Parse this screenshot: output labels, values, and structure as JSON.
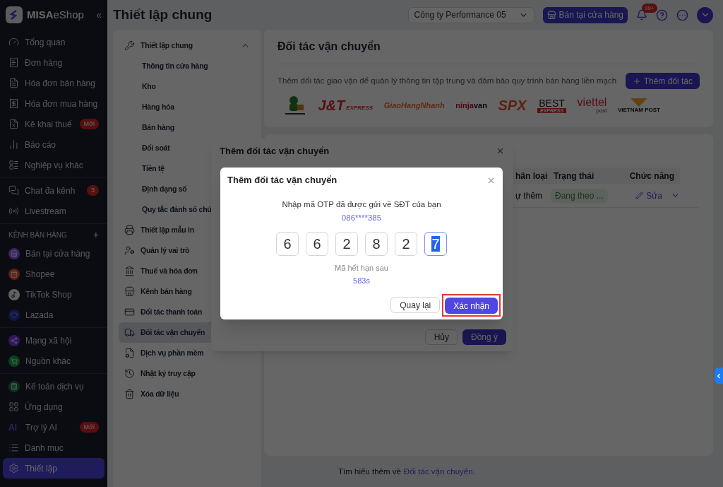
{
  "sidebar": {
    "brand": "MISA",
    "brand_suffix": "eShop",
    "collapse": "«",
    "groups": [
      {
        "items": [
          {
            "label": "Tổng quan",
            "selected": false
          },
          {
            "label": "Đơn hàng",
            "selected": false
          },
          {
            "label": "Hóa đơn bán hàng",
            "selected": false
          },
          {
            "label": "Hóa đơn mua hàng",
            "selected": false
          },
          {
            "label": "Kê khai thuế",
            "badge": "Mới",
            "selected": false
          },
          {
            "label": "Báo cáo",
            "selected": false
          },
          {
            "label": "Nghiệp vụ khác",
            "selected": false
          }
        ]
      },
      {
        "items": [
          {
            "label": "Chat đa kênh",
            "badge": "3",
            "selected": false
          },
          {
            "label": "Livestream",
            "selected": false
          }
        ]
      },
      {
        "heading": "KÊNH BÁN HÀNG",
        "heading_action": "+",
        "items": [
          {
            "label": "Bán tại cửa hàng",
            "selected": false
          },
          {
            "label": "Shopee",
            "selected": false
          },
          {
            "label": "TikTok Shop",
            "selected": false
          },
          {
            "label": "Lazada",
            "selected": false
          }
        ]
      },
      {
        "items": [
          {
            "label": "Mạng xã hội",
            "selected": false
          },
          {
            "label": "Nguồn khác",
            "selected": false
          }
        ]
      },
      {
        "items": [
          {
            "label": "Kế toán dịch vụ",
            "selected": false
          },
          {
            "label": "Ứng dụng",
            "selected": false
          },
          {
            "label": "Trợ lý AI",
            "icon_text": "Ai",
            "badge": "Mới",
            "selected": false
          },
          {
            "label": "Danh mục",
            "selected": false
          },
          {
            "label": "Thiết lập",
            "selected": true
          }
        ]
      }
    ]
  },
  "header": {
    "title": "Thiết lập chung",
    "company": "Công ty Performance 05",
    "store_button": "Bán tại cửa hàng",
    "notifications": "99+"
  },
  "settings_nav": [
    {
      "label": "Thiết lập chung",
      "expanded": true,
      "children": [
        {
          "label": "Thông tin cửa hàng"
        },
        {
          "label": "Kho"
        },
        {
          "label": "Hàng hóa"
        },
        {
          "label": "Bán hàng"
        },
        {
          "label": "Đối soát"
        },
        {
          "label": "Tiền tệ"
        },
        {
          "label": "Định dạng số"
        },
        {
          "label": "Quy tắc đánh số chứ"
        }
      ]
    },
    {
      "label": "Thiết lập mẫu in",
      "selected": false
    },
    {
      "label": "Quản lý vai trò",
      "selected": false
    },
    {
      "label": "Thuế và hóa đơn",
      "selected": false
    },
    {
      "label": "Kênh bán hàng",
      "selected": false
    },
    {
      "label": "Đối tác thanh toán",
      "selected": false
    },
    {
      "label": "Đối tác vận chuyển",
      "selected": true
    },
    {
      "label": "Dịch vụ phần mềm",
      "selected": false
    },
    {
      "label": "Nhật ký truy cập",
      "selected": false
    },
    {
      "label": "Xóa dữ liệu",
      "selected": false
    }
  ],
  "partners": {
    "title": "Đối tác vận chuyển",
    "description": "Thêm đối tác giao vận để quản lý thông tin tập trung và đảm bảo quy trình bán hàng liền mạch",
    "add_button": "Thêm đối tác",
    "logos": [
      {
        "kind": "mascot"
      },
      {
        "kind": "jt",
        "text": "J&T",
        "sub": "EXPRESS"
      },
      {
        "kind": "ghn",
        "text": "GiaoHangNhanh"
      },
      {
        "kind": "ninja",
        "text": "ninja",
        "sub": "van"
      },
      {
        "kind": "spx",
        "text": "SPX"
      },
      {
        "kind": "best",
        "text": "BEST",
        "sub": "EXPRESS"
      },
      {
        "kind": "viettel",
        "text": "viettel",
        "sub": "post"
      },
      {
        "kind": "vnpost",
        "sub": "VIETNAM POST"
      }
    ]
  },
  "table": {
    "columns": [
      "hân loại",
      "Trạng thái",
      "Chức năng"
    ],
    "rows": [
      {
        "type": "ự thêm",
        "status": "Đang theo ...",
        "action": "Sửa"
      }
    ]
  },
  "footer": {
    "text": "Tìm hiểu thêm về",
    "link": "Đối tác vận chuyển."
  },
  "add_dialog": {
    "title": "Thêm đối tác vận chuyển",
    "cancel": "Hủy",
    "ok": "Đồng ý"
  },
  "otp_dialog": {
    "title": "Thêm đối tác vận chuyển",
    "prompt": "Nhập mã OTP đã được gửi về SĐT của bạn",
    "phone": "086****385",
    "digits": [
      {
        "value": "6",
        "selected": false
      },
      {
        "value": "6",
        "selected": false
      },
      {
        "value": "2",
        "selected": false
      },
      {
        "value": "8",
        "selected": false
      },
      {
        "value": "2",
        "selected": false
      },
      {
        "value": "7",
        "selected": true
      }
    ],
    "expiry_label": "Mã hết hạn sau",
    "expiry": "583s",
    "back": "Quay lại",
    "confirm": "Xác nhận",
    "confirm_highlighted": true
  }
}
